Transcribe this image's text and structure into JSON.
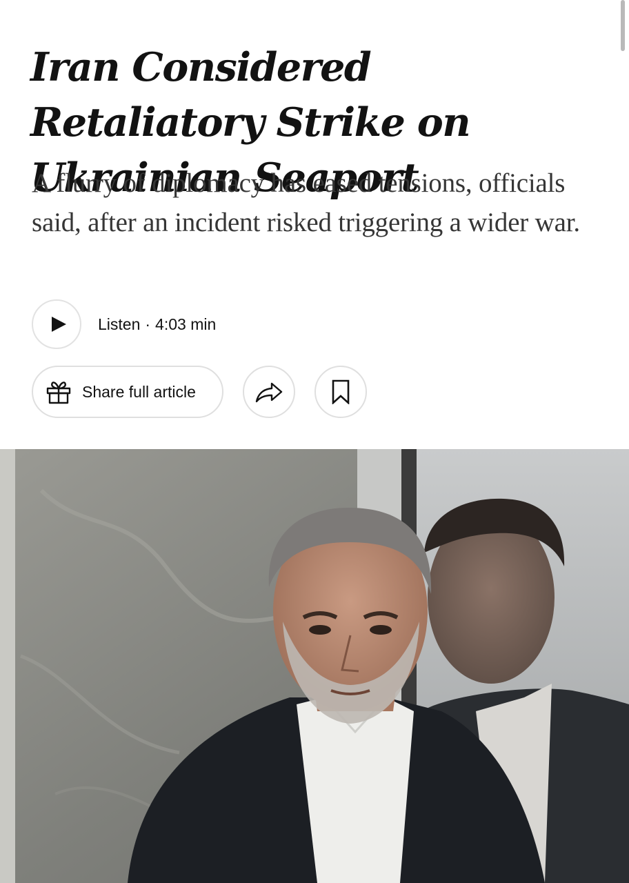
{
  "article": {
    "headline": "Iran Considered Retaliatory Strike on Ukrainian Seaport",
    "summary": "A flurry of diplomacy has eased tensions, officials said, after an incident risked triggering a wider war."
  },
  "audio": {
    "listen_label": "Listen",
    "separator": "·",
    "duration": "4:03 min",
    "play_icon": "play-icon"
  },
  "actions": {
    "share_full_label": "Share full article",
    "gift_icon": "gift-icon",
    "share_icon": "share-arrow-icon",
    "save_icon": "bookmark-icon"
  },
  "colors": {
    "text": "#121212",
    "summary_text": "#363636",
    "button_border": "#dfdfdf"
  }
}
